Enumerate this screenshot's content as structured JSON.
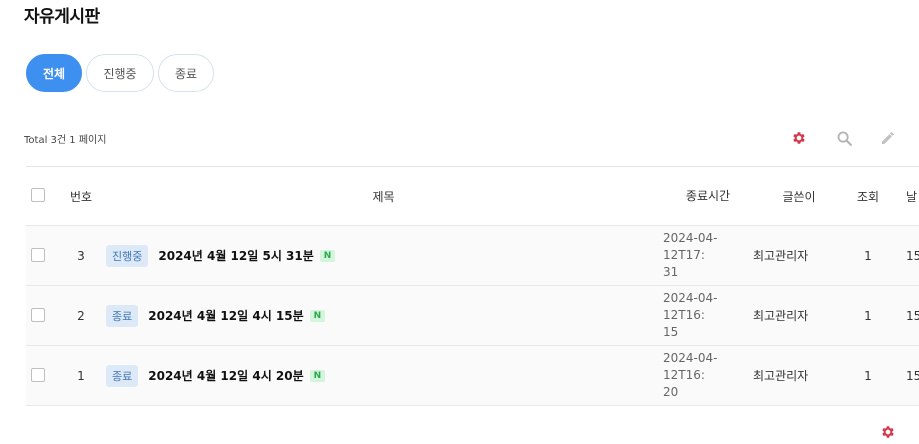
{
  "page_title": "자유게시판",
  "tabs": [
    {
      "label": "전체",
      "active": true
    },
    {
      "label": "진행중",
      "active": false
    },
    {
      "label": "종료",
      "active": false
    }
  ],
  "total_text": "Total 3건 1 페이지",
  "toolbar": {
    "settings_icon": "gear-icon",
    "search_icon": "search-icon",
    "write_icon": "pencil-icon",
    "accent_color": "#d3394c"
  },
  "table": {
    "headers": {
      "num": "번호",
      "subject": "제목",
      "end_time": "종료시간",
      "author": "글쓴이",
      "views": "조회",
      "date": "날"
    },
    "rows": [
      {
        "num": "3",
        "status": "진행중",
        "title": "2024년 4월 12일 5시 31분",
        "new": "N",
        "end_time": "2024-04-12T17:\n31",
        "author": "최고관리자",
        "views": "1",
        "date": "15"
      },
      {
        "num": "2",
        "status": "종료",
        "title": "2024년 4월 12일 4시 15분",
        "new": "N",
        "end_time": "2024-04-12T16:\n15",
        "author": "최고관리자",
        "views": "1",
        "date": "15"
      },
      {
        "num": "1",
        "status": "종료",
        "title": "2024년 4월 12일 4시 20분",
        "new": "N",
        "end_time": "2024-04-12T16:\n20",
        "author": "최고관리자",
        "views": "1",
        "date": "15"
      }
    ]
  }
}
